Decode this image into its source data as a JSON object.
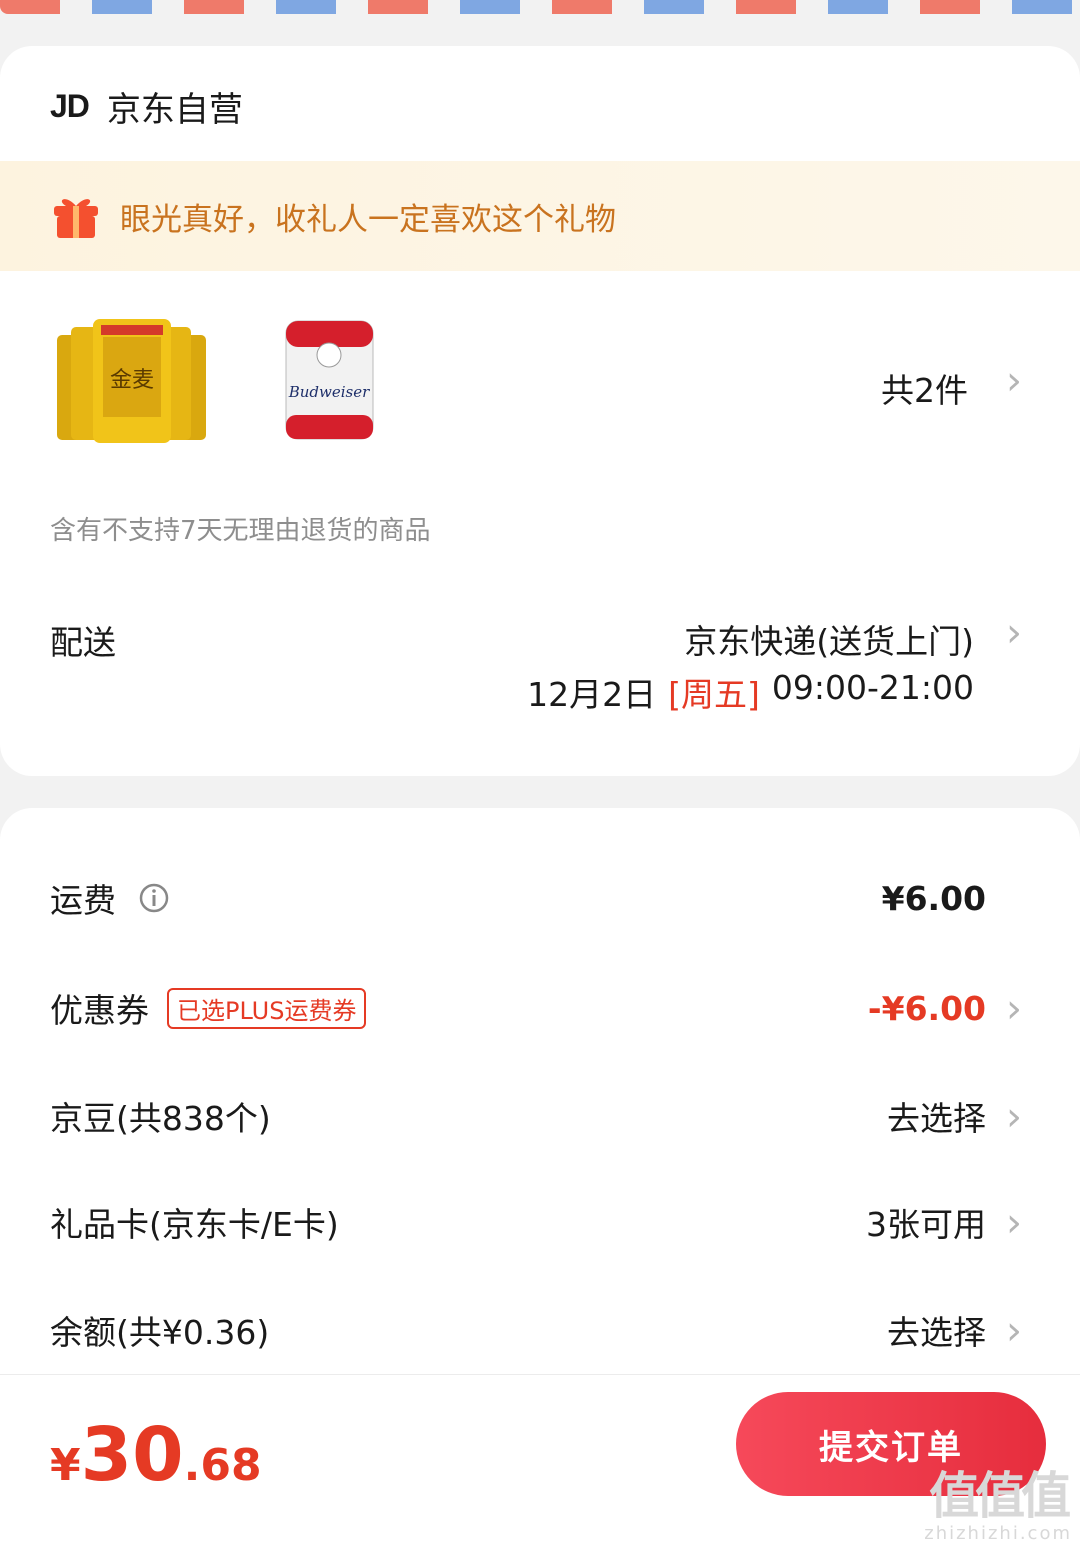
{
  "store": {
    "logo": "JD",
    "name": "京东自营"
  },
  "gift_banner": {
    "text": "眼光真好，收礼人一定喜欢这个礼物",
    "icon": "gift-icon"
  },
  "products": {
    "count_label": "共2件",
    "images": [
      "gold-beer-six-pack",
      "budweiser-can"
    ]
  },
  "return_note": "含有不支持7天无理由退货的商品",
  "shipping": {
    "label": "配送",
    "method": "京东快递(送货上门)",
    "date": "12月2日",
    "weekday": "[周五]",
    "time": "09:00-21:00"
  },
  "fees": {
    "freight": {
      "label": "运费",
      "value": "¥6.00"
    },
    "coupon": {
      "label": "优惠券",
      "tag": "已选PLUS运费券",
      "value": "-¥6.00"
    },
    "jingdou": {
      "label": "京豆(共838个)",
      "value": "去选择"
    },
    "giftcard": {
      "label": "礼品卡(京东卡/E卡)",
      "value": "3张可用"
    },
    "balance": {
      "label": "余额(共¥0.36)",
      "value": "去选择"
    }
  },
  "footer": {
    "currency": "¥",
    "total_int": "30",
    "total_dec": ".68",
    "submit_label": "提交订单"
  },
  "watermark": {
    "big": "值值值",
    "small": "zhizhizhi.com"
  },
  "colors": {
    "accent": "#e53a24",
    "banner_text": "#c9731f",
    "button": "#f23e4e"
  }
}
